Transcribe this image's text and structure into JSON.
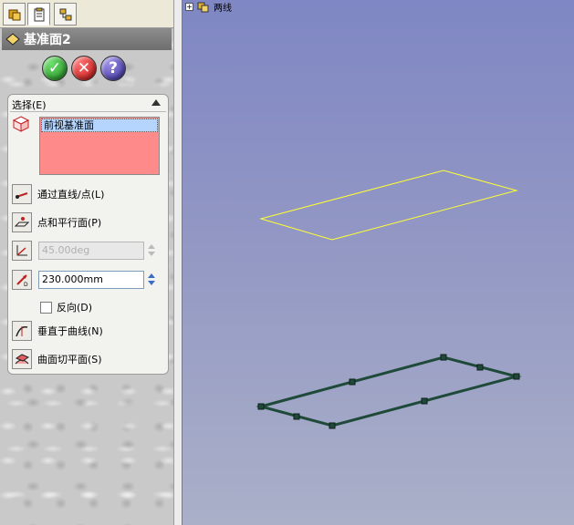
{
  "panel": {
    "tabs": [
      {
        "name": "feature-manager",
        "icon": "feature-tree-icon"
      },
      {
        "name": "property-manager",
        "icon": "property-clipboard-icon"
      },
      {
        "name": "configuration-manager",
        "icon": "configuration-icon"
      }
    ],
    "title": "基准面2",
    "title_icon": "plane-icon",
    "actions": {
      "ok": "✓",
      "cancel": "✕",
      "help": "?"
    },
    "group_label": "选择(E)",
    "selection_items": [
      "前视基准面"
    ],
    "options": {
      "through_lines": "通过直线/点(L)",
      "point_parallel": "点和平行面(P)",
      "angle_value": "45.00deg",
      "offset_value": "230.000mm",
      "reverse": "反向(D)",
      "normal_to_curve": "垂直于曲线(N)",
      "on_surface": "曲面切平面(S)"
    }
  },
  "viewport": {
    "tree_label": "两线",
    "colors": {
      "background_top": "#7f87c4",
      "background_bottom": "#aab0c8",
      "preview_plane": "#ffff33",
      "selected_plane": "#1f4a3a"
    }
  }
}
